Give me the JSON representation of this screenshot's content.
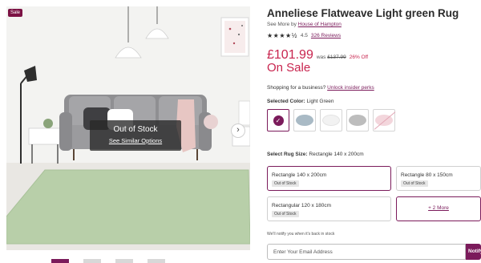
{
  "colors": {
    "brand": "#7b1b5b",
    "sale_red": "#c8244e",
    "sale_tag_bg": "#7b1244"
  },
  "image": {
    "sale_tag": "Sale",
    "overlay_title": "Out of Stock",
    "overlay_link": "See Similar Options",
    "next_icon": "chevron-right-icon",
    "next_glyph": "›"
  },
  "product": {
    "title": "Anneliese Flatweave Light green Rug",
    "see_more_prefix": "See More by",
    "brand": "House of Hampton",
    "stars_glyphs": "★★★★½",
    "rating": 4.5,
    "rating_text": "4.5",
    "reviews": "326 Reviews"
  },
  "price": {
    "current": "£101.99",
    "was_prefix": "was",
    "was": "£137.99",
    "off": "26% Off",
    "on_sale": "On Sale"
  },
  "business": {
    "prefix": "Shopping for a business?",
    "link": "Unlock insider perks"
  },
  "color": {
    "label": "Selected Color:",
    "value": "Light Green",
    "check_glyph": "✓",
    "swatches": [
      {
        "name": "Light Green",
        "selected": true,
        "color": "#b7cfa8"
      },
      {
        "name": "Blue Grey",
        "selected": false,
        "color": "#a9bac5"
      },
      {
        "name": "White",
        "selected": false,
        "color": "#f2f2f2"
      },
      {
        "name": "Grey",
        "selected": false,
        "color": "#bdbdbd"
      },
      {
        "name": "Pink",
        "selected": false,
        "color": "#f3d6dc",
        "unavailable": true
      }
    ]
  },
  "size": {
    "label": "Select Rug Size:",
    "value": "Rectangle 140 x 200cm",
    "options": [
      {
        "label": "Rectangle 140 x 200cm",
        "status": "Out of Stock",
        "selected": true
      },
      {
        "label": "Rectangle 80 x 150cm",
        "status": "Out of Stock",
        "selected": false
      },
      {
        "label": "Rectangular 120 x 180cm",
        "status": "Out of Stock",
        "selected": false
      }
    ],
    "more": "+ 2 More"
  },
  "notify": {
    "message": "We'll notify you when it's back in stock",
    "email_placeholder": "Enter Your Email Address",
    "button": "Notify Me"
  }
}
